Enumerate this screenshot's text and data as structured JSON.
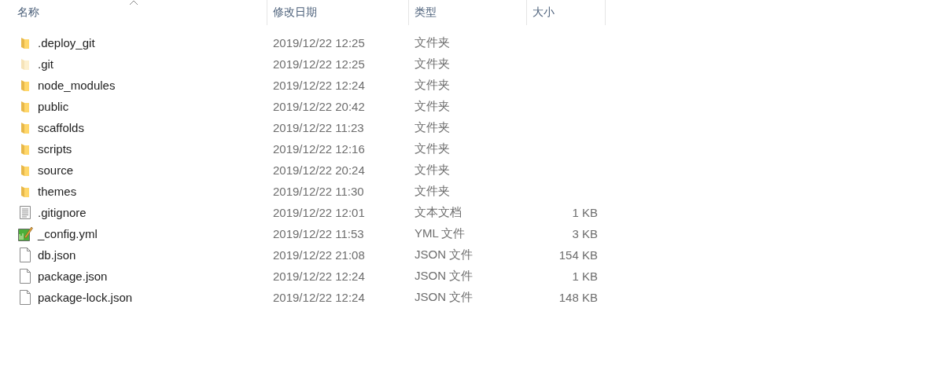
{
  "columns": [
    {
      "label": "名称",
      "sorted": true
    },
    {
      "label": "修改日期",
      "sorted": false
    },
    {
      "label": "类型",
      "sorted": false
    },
    {
      "label": "大小",
      "sorted": false
    }
  ],
  "files": [
    {
      "name": ".deploy_git",
      "modified": "2019/12/22 12:25",
      "type": "文件夹",
      "kind": "folder",
      "hidden": false
    },
    {
      "name": ".git",
      "modified": "2019/12/22 12:25",
      "type": "文件夹",
      "kind": "folder",
      "hidden": true
    },
    {
      "name": "node_modules",
      "modified": "2019/12/22 12:24",
      "type": "文件夹",
      "kind": "folder",
      "hidden": false
    },
    {
      "name": "public",
      "modified": "2019/12/22 20:42",
      "type": "文件夹",
      "kind": "folder",
      "hidden": false
    },
    {
      "name": "scaffolds",
      "modified": "2019/12/22 11:23",
      "type": "文件夹",
      "kind": "folder",
      "hidden": false
    },
    {
      "name": "scripts",
      "modified": "2019/12/22 12:16",
      "type": "文件夹",
      "kind": "folder",
      "hidden": false
    },
    {
      "name": "source",
      "modified": "2019/12/22 20:24",
      "type": "文件夹",
      "kind": "folder",
      "hidden": false
    },
    {
      "name": "themes",
      "modified": "2019/12/22 11:30",
      "type": "文件夹",
      "kind": "folder",
      "hidden": false
    },
    {
      "name": ".gitignore",
      "modified": "2019/12/22 12:01",
      "type": "文本文档",
      "size": "1 KB",
      "kind": "text",
      "hidden": false
    },
    {
      "name": "_config.yml",
      "modified": "2019/12/22 11:53",
      "type": "YML 文件",
      "size": "3 KB",
      "kind": "yml",
      "hidden": false
    },
    {
      "name": "db.json",
      "modified": "2019/12/22 21:08",
      "type": "JSON 文件",
      "size": "154 KB",
      "kind": "file",
      "hidden": false
    },
    {
      "name": "package.json",
      "modified": "2019/12/22 12:24",
      "type": "JSON 文件",
      "size": "1 KB",
      "kind": "file",
      "hidden": false
    },
    {
      "name": "package-lock.json",
      "modified": "2019/12/22 12:24",
      "type": "JSON 文件",
      "size": "148 KB",
      "kind": "file",
      "hidden": false
    }
  ]
}
